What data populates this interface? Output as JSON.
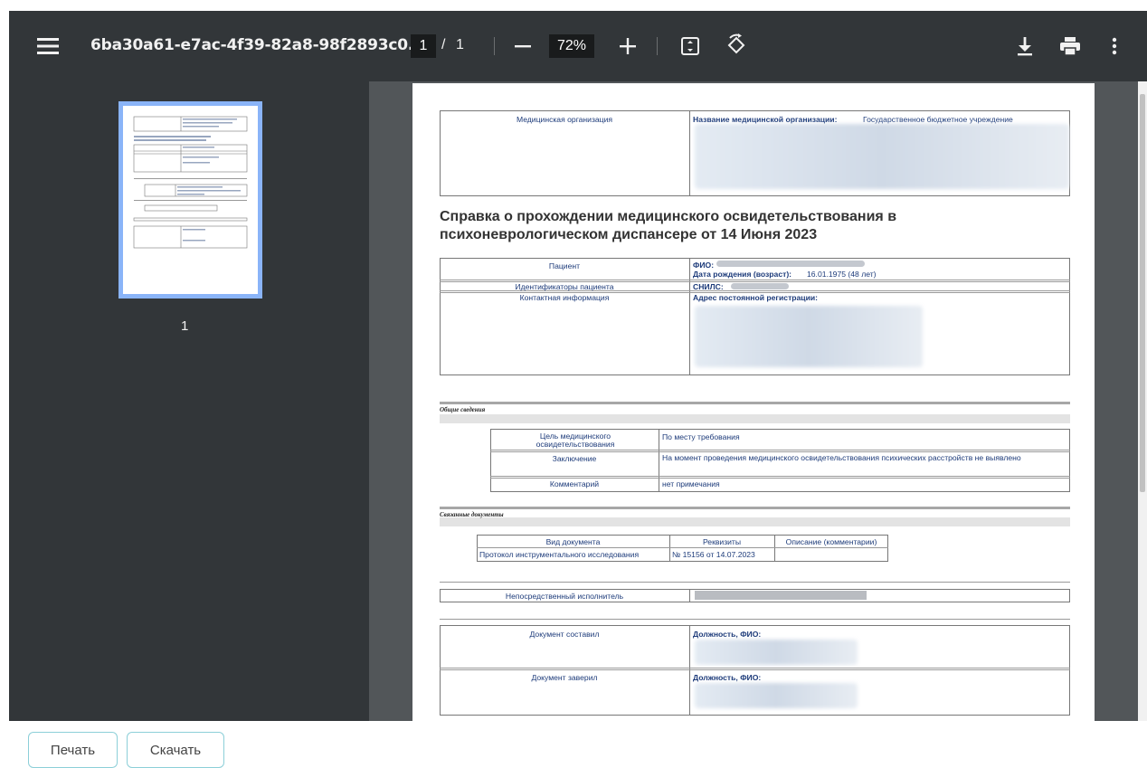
{
  "toolbar": {
    "title": "6ba30a61-e7ac-4f39-82a8-98f2893c0...",
    "page_current": "1",
    "page_separator": "/",
    "page_total": "1",
    "zoom": "72%"
  },
  "sidebar": {
    "thumbnail_label": "1"
  },
  "document": {
    "org_label": "Медицинская организация",
    "org_name_key": "Название медицинской организации:",
    "org_name_value": "Государственное бюджетное учреждение",
    "heading_line1": "Справка о прохождении медицинского освидетельствования в",
    "heading_line2": "психоневрологическом диспансере от 14 Июня 2023",
    "patient_label": "Пациент",
    "patient_fio_key": "ФИО:",
    "patient_dob_key": "Дата рождения (возраст):",
    "patient_dob_value": "16.01.1975 (48 лет)",
    "ids_label": "Идентификаторы пациента",
    "snils_key": "СНИЛС:",
    "contact_label": "Контактная информация",
    "address_key": "Адрес постоянной регистрации:",
    "section_general": "Общие сведения",
    "purpose_label": "Цель медицинского освидетельствования",
    "purpose_value": "По месту требования",
    "conclusion_label": "Заключение",
    "conclusion_value": "На момент проведения медицинского освидетельствования психических расстройств не выявлено",
    "comment_label": "Комментарий",
    "comment_value": "нет примечания",
    "section_related": "Связанные документы",
    "col_doc_type": "Вид документа",
    "col_requisites": "Реквизиты",
    "col_description": "Описание (комментарии)",
    "row_doc_type": "Протокол инструментального исследования",
    "row_requisites": "№ 15156 от 14.07.2023",
    "executor_label": "Непосредственный исполнитель",
    "composed_label": "Документ составил",
    "position_key": "Должность, ФИО:",
    "certified_label": "Документ заверил",
    "position_key2": "Должность, ФИО:"
  },
  "buttons": {
    "print": "Печать",
    "download": "Скачать"
  }
}
